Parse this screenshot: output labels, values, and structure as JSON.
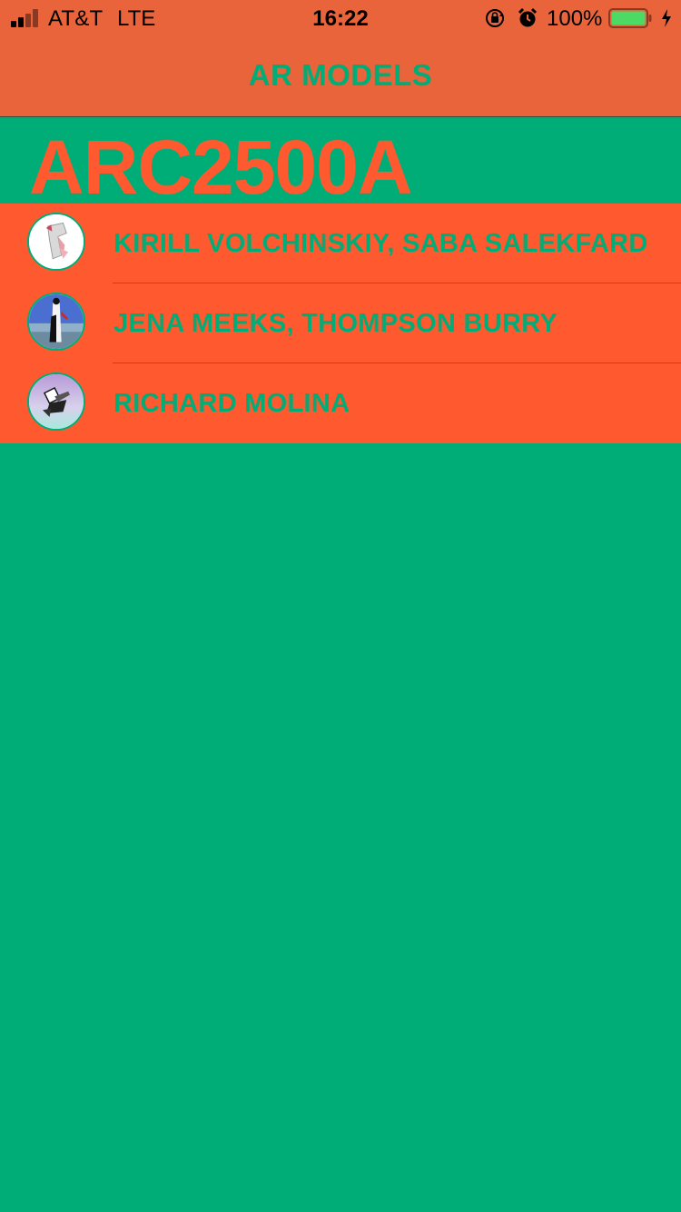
{
  "status_bar": {
    "carrier": "AT&T",
    "network": "LTE",
    "time": "16:22",
    "battery_percent": "100%",
    "signal_icon": "signal-bars-icon",
    "rotation_lock_icon": "rotation-lock-icon",
    "alarm_icon": "alarm-icon",
    "battery_icon": "battery-icon",
    "charging_icon": "charging-bolt-icon"
  },
  "nav": {
    "title": "AR MODELS"
  },
  "page": {
    "large_title": "ARC2500A"
  },
  "list": {
    "items": [
      {
        "label": "KIRILL VOLCHINSKIY, SABA SALEKFARD",
        "avatar": "model-thumbnail-1"
      },
      {
        "label": "JENA MEEKS, THOMPSON BURRY",
        "avatar": "model-thumbnail-2"
      },
      {
        "label": "RICHARD MOLINA",
        "avatar": "model-thumbnail-3"
      }
    ]
  },
  "colors": {
    "background": "#00AD77",
    "nav_bar": "#E9643B",
    "accent": "#FF5A2F",
    "text_green": "#00AD77",
    "battery_fill": "#4CD964"
  }
}
